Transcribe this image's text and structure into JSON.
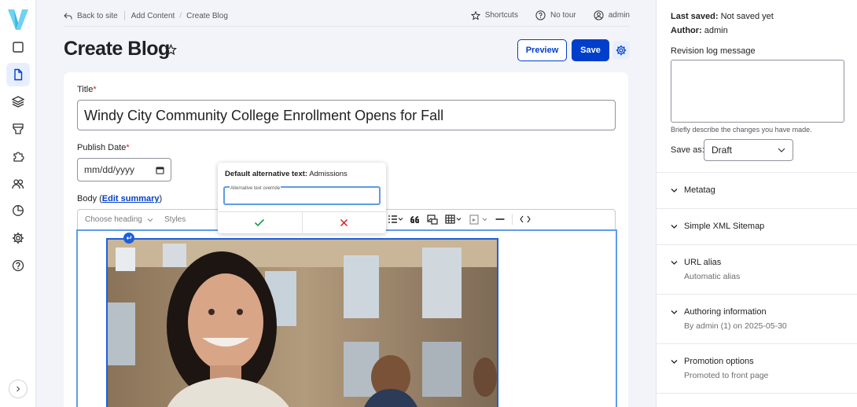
{
  "rail": {
    "items": [
      "content-icon",
      "document-icon",
      "layers-icon",
      "brush-icon",
      "puzzle-icon",
      "people-icon",
      "chart-icon",
      "gear-icon",
      "help-icon"
    ],
    "active_index": 1,
    "accent": "#003ecc"
  },
  "topbar": {
    "back_label": "Back to site",
    "crumb_1": "Add Content",
    "crumb_2": "Create Blog",
    "shortcuts_label": "Shortcuts",
    "tour_label": "No tour",
    "user_label": "admin"
  },
  "header": {
    "title": "Create Blog",
    "preview_label": "Preview",
    "save_label": "Save"
  },
  "form": {
    "title_label": "Title",
    "title_value": "Windy City Community College Enrollment Opens for Fall",
    "publish_label": "Publish Date",
    "date_placeholder": "mm/dd/yyyy",
    "body_label": "Body (",
    "edit_summary_link": "Edit summary",
    "body_label_close": ")",
    "required_mark": "*"
  },
  "toolbar": {
    "heading_label": "Choose heading",
    "styles_label": "Styles"
  },
  "balloon": {
    "default_alt_label": "Default alternative text:",
    "default_alt_value": "Admissions",
    "override_label": "Alternative text override",
    "override_value": ""
  },
  "sidebar": {
    "last_saved_label": "Last saved:",
    "last_saved_value": "Not saved yet",
    "author_label": "Author:",
    "author_value": "admin",
    "revision_label": "Revision log message",
    "revision_hint": "Briefly describe the changes you have made.",
    "save_as_label": "Save as:",
    "save_as_value": "Draft",
    "sections": [
      {
        "title": "Metatag",
        "summary": ""
      },
      {
        "title": "Simple XML Sitemap",
        "summary": ""
      },
      {
        "title": "URL alias",
        "summary": "Automatic alias"
      },
      {
        "title": "Authoring information",
        "summary": "By admin (1) on 2025-05-30"
      },
      {
        "title": "Promotion options",
        "summary": "Promoted to front page"
      }
    ]
  }
}
